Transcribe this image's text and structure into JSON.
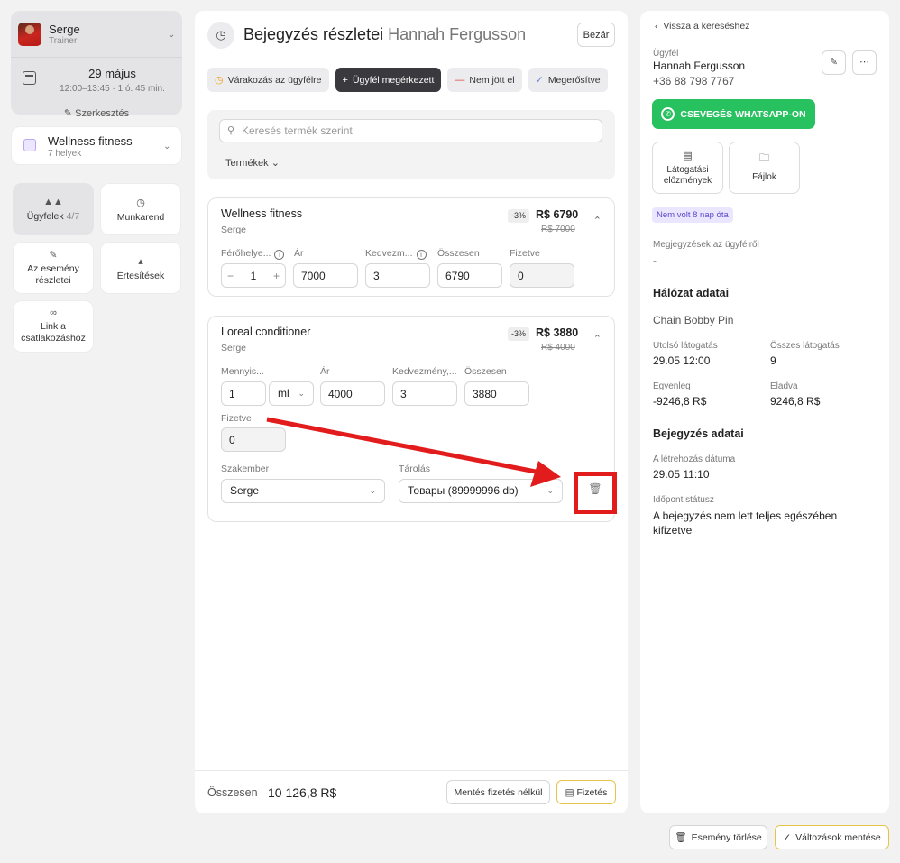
{
  "staff": {
    "name": "Serge",
    "role": "Trainer"
  },
  "event": {
    "date": "29 május",
    "time": "12:00–13:45 · 1 ó. 45 min.",
    "edit_label": "Szerkesztés"
  },
  "service": {
    "name": "Wellness fitness",
    "places": "7 helyek"
  },
  "nav": {
    "clients_label": "Ügyfelek",
    "clients_count": "4/7",
    "schedule_label": "Munkarend",
    "event_details_label_1": "Az esemény",
    "event_details_label_2": "részletei",
    "notifications_label": "Értesítések",
    "link_label_1": "Link a",
    "link_label_2": "csatlakozáshoz"
  },
  "header": {
    "title": "Bejegyzés részletei",
    "client": "Hannah Fergusson",
    "close_label": "Bezár"
  },
  "statuses": [
    {
      "label": "Várakozás az ügyfélre",
      "icon": "clock-icon"
    },
    {
      "label": "Ügyfél megérkezett",
      "icon": "plus-icon"
    },
    {
      "label": "Nem jött el",
      "icon": "minus-icon"
    },
    {
      "label": "Megerősítve",
      "icon": "check-icon"
    }
  ],
  "search": {
    "placeholder": "Keresés termék szerint",
    "products_label": "Termékek"
  },
  "items": [
    {
      "name": "Wellness fitness",
      "staff": "Serge",
      "discount_badge": "-3%",
      "price": "R$ 6790",
      "price_old": "R$ 7000",
      "labels": {
        "places": "Férőhelye...",
        "price": "Ár",
        "discount": "Kedvezm...",
        "total": "Összesen",
        "paid": "Fizetve"
      },
      "values": {
        "places": "1",
        "price": "7000",
        "discount": "3",
        "total": "6790",
        "paid": "0"
      }
    },
    {
      "name": "Loreal conditioner",
      "staff": "Serge",
      "discount_badge": "-3%",
      "price": "R$ 3880",
      "price_old": "R$ 4000",
      "labels": {
        "quantity": "Mennyis...",
        "price": "Ár",
        "discount": "Kedvezmény,...",
        "total": "Összesen",
        "paid": "Fizetve",
        "specialist": "Szakember",
        "storage": "Tárolás"
      },
      "values": {
        "quantity": "1",
        "unit": "ml",
        "price": "4000",
        "discount": "3",
        "total": "3880",
        "paid": "0",
        "specialist": "Serge",
        "storage": "Товары (89999996 db)"
      }
    }
  ],
  "footer": {
    "total_label": "Összesen",
    "total_value": "10 126,8 R$",
    "save_without_payment": "Mentés fizetés nélkül",
    "pay": "Fizetés"
  },
  "client_panel": {
    "back_label": "Vissza a kereséshez",
    "client_label": "Ügyfél",
    "client_name": "Hannah Fergusson",
    "client_phone": "+36 88 798 7767",
    "whatsapp_label": "CSEVEGÉS WHATSAPP-ON",
    "visit_history_1": "Látogatási",
    "visit_history_2": "előzmények",
    "files_label": "Fájlok",
    "not_visited_badge": "Nem volt 8 nap óta",
    "notes_label": "Megjegyzések az ügyfélről",
    "notes_value": "-",
    "network_title": "Hálózat adatai",
    "network_name": "Chain Bobby Pin",
    "last_visit_label": "Utolsó látogatás",
    "last_visit_value": "29.05 12:00",
    "total_visits_label": "Összes látogatás",
    "total_visits_value": "9",
    "balance_label": "Egyenleg",
    "balance_value": "-9246,8 R$",
    "sold_label": "Eladva",
    "sold_value": "9246,8 R$",
    "booking_title": "Bejegyzés adatai",
    "created_label": "A létrehozás dátuma",
    "created_value": "29.05 11:10",
    "status_label": "Időpont státusz",
    "status_value": "A bejegyzés nem lett teljes egészében kifizetve"
  },
  "bottom": {
    "delete_event": "Esemény törlése",
    "save_changes": "Változások mentése"
  },
  "colors": {
    "whatsapp": "#27c160",
    "annotation": "#e21c1c",
    "accent_yellow": "#e8c34a",
    "dark_button": "#3a3a3e"
  }
}
